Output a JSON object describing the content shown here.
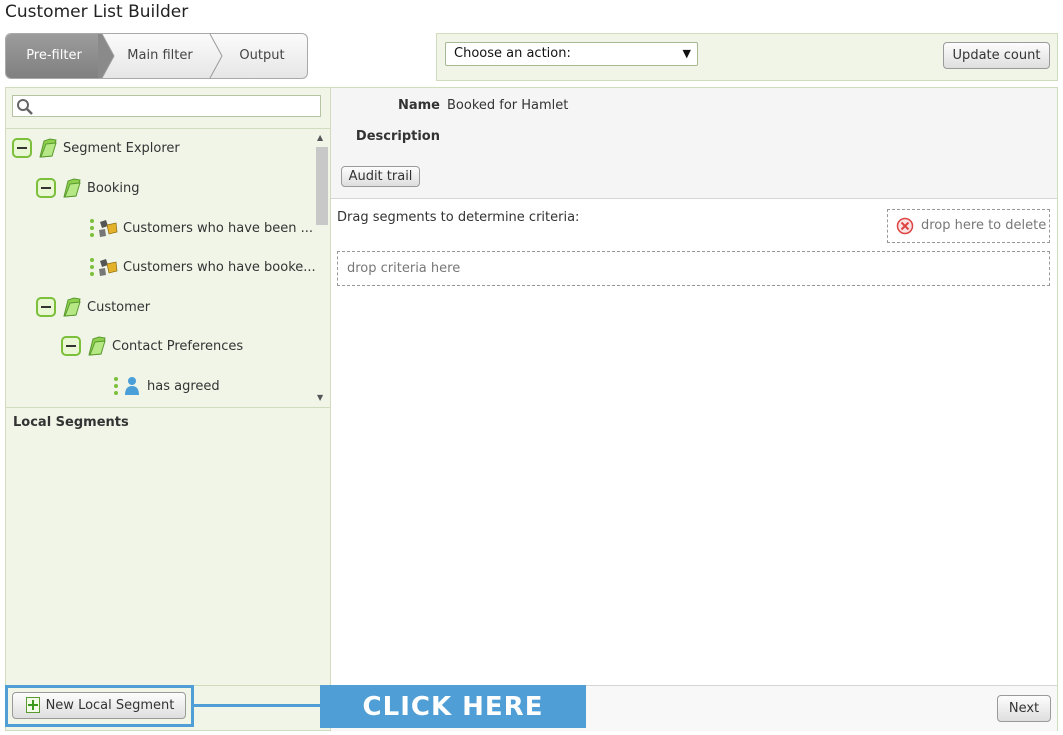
{
  "app": {
    "title": "Customer List Builder"
  },
  "stepper": {
    "steps": [
      "Pre-filter",
      "Main filter",
      "Output"
    ],
    "active": 0
  },
  "actions": {
    "selected": "Choose an action:",
    "update_label": "Update count"
  },
  "search": {
    "placeholder": ""
  },
  "tree": {
    "root": "Segment Explorer",
    "booking": "Booking",
    "booking_items": [
      "Customers who have been ...",
      "Customers who have booke..."
    ],
    "customer": "Customer",
    "contact_prefs": "Contact Preferences",
    "contact_items": [
      "has agreed"
    ]
  },
  "local_segments": {
    "title": "Local Segments",
    "new_label": "New Local Segment"
  },
  "callout": {
    "text": "CLICK HERE"
  },
  "details": {
    "name_label": "Name",
    "name_value": "Booked for Hamlet",
    "description_label": "Description",
    "audit_label": "Audit trail"
  },
  "criteria": {
    "instruction": "Drag segments to determine criteria:",
    "delete_zone": "drop here to delete",
    "drop_zone": "drop criteria here"
  },
  "footer": {
    "next_label": "Next"
  },
  "colors": {
    "accent_green": "#7cbf3a",
    "panel_bg": "#f1f5e8",
    "callout_blue": "#4f9fd6"
  }
}
